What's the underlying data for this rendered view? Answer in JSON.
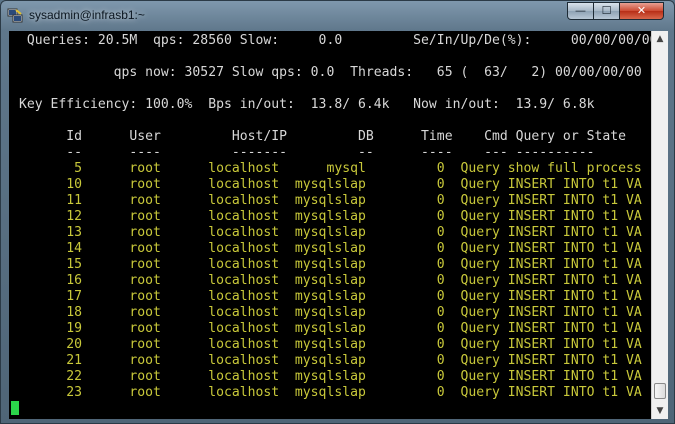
{
  "window": {
    "title": "sysadmin@infrasb1:~",
    "buttons": {
      "minimize": "—",
      "maximize": "☐",
      "close": "✕"
    }
  },
  "colors": {
    "terminal_bg": "#000000",
    "text": "#d8d8d8",
    "rows": "#c8c83a",
    "cursor": "#2bd44a"
  },
  "terminal": {
    "header": [
      " Queries: 20.5M  qps: 28560 Slow:     0.0         Se/In/Up/De(%):     00/00/00/00",
      "",
      "            qps now: 30527 Slow qps: 0.0  Threads:   65 (  63/   2) 00/00/00/00",
      "",
      "Key Efficiency: 100.0%  Bps in/out:  13.8/ 6.4k   Now in/out:  13.9/ 6.8k",
      "",
      "      Id      User         Host/IP         DB      Time    Cmd Query or State",
      "      --      ----         -------         --      ----    --- ----------"
    ],
    "rows": [
      "       5      root      localhost      mysql         0  Query show full process",
      "      10      root      localhost  mysqlslap         0  Query INSERT INTO t1 VA",
      "      11      root      localhost  mysqlslap         0  Query INSERT INTO t1 VA",
      "      12      root      localhost  mysqlslap         0  Query INSERT INTO t1 VA",
      "      13      root      localhost  mysqlslap         0  Query INSERT INTO t1 VA",
      "      14      root      localhost  mysqlslap         0  Query INSERT INTO t1 VA",
      "      15      root      localhost  mysqlslap         0  Query INSERT INTO t1 VA",
      "      16      root      localhost  mysqlslap         0  Query INSERT INTO t1 VA",
      "      17      root      localhost  mysqlslap         0  Query INSERT INTO t1 VA",
      "      18      root      localhost  mysqlslap         0  Query INSERT INTO t1 VA",
      "      19      root      localhost  mysqlslap         0  Query INSERT INTO t1 VA",
      "      20      root      localhost  mysqlslap         0  Query INSERT INTO t1 VA",
      "      21      root      localhost  mysqlslap         0  Query INSERT INTO t1 VA",
      "      22      root      localhost  mysqlslap         0  Query INSERT INTO t1 VA",
      "      23      root      localhost  mysqlslap         0  Query INSERT INTO t1 VA"
    ]
  },
  "scrollbar": {
    "up_icon": "up-arrow-icon",
    "down_icon": "down-arrow-icon"
  }
}
